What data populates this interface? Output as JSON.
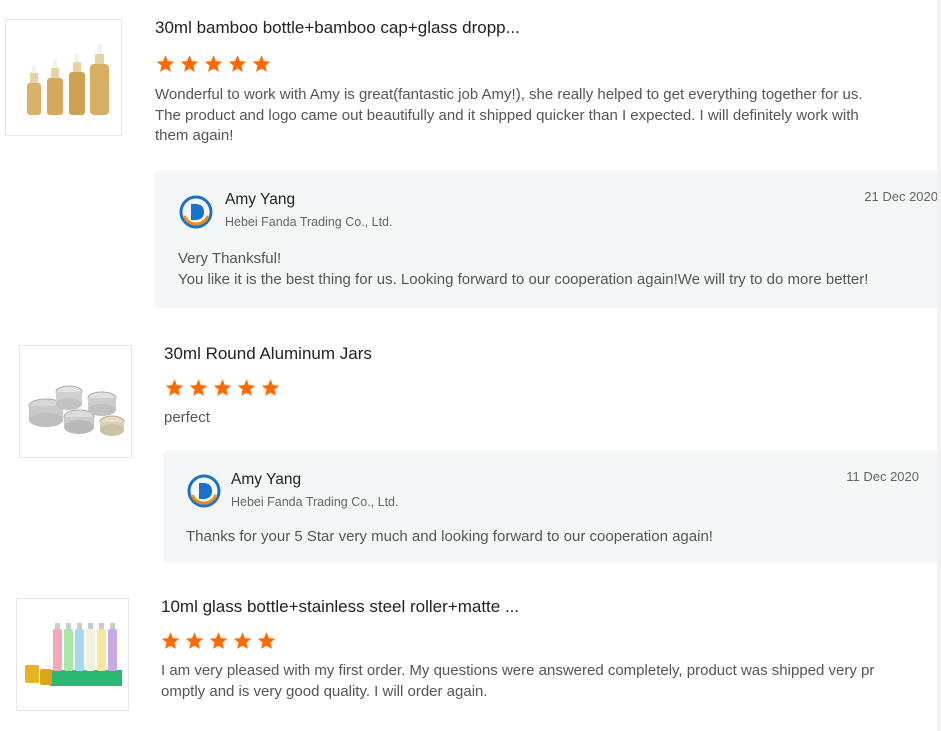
{
  "reviews": [
    {
      "product_title": "30ml bamboo bottle+bamboo cap+glass dropp...",
      "rating": 5,
      "text_lines": [
        "Wonderful to work with Amy is great(fantastic job Amy!), she really helped to get everything together for us.",
        "The product and logo came out beautifully and it shipped quicker than I expected. I will definitely work with",
        "them again!"
      ],
      "reply": {
        "name": "Amy Yang",
        "company": "Hebei Fanda Trading Co., Ltd.",
        "date": "21 Dec 2020",
        "lines": [
          "Very Thanksful!",
          "You like it is the best thing for us. Looking forward to our cooperation again!We will try to do more better!"
        ]
      }
    },
    {
      "product_title": "30ml Round Aluminum Jars",
      "rating": 5,
      "text_lines": [
        "perfect"
      ],
      "reply": {
        "name": "Amy Yang",
        "company": "Hebei Fanda Trading Co., Ltd.",
        "date": "11 Dec 2020",
        "lines": [
          "Thanks for your 5 Star very much and looking forward to our cooperation again!"
        ]
      }
    },
    {
      "product_title": "10ml glass bottle+stainless steel roller+matte ...",
      "rating": 5,
      "text_lines": [
        "I am very pleased with my first order. My questions were answered completely, product was shipped very pr",
        "omptly and is very good quality. I will order again."
      ]
    }
  ],
  "colors": {
    "star": "#ff6a00",
    "reply_bg": "#f5f6f8",
    "logo_blue": "#1a73c8",
    "logo_orange": "#f08a1c"
  },
  "icons": {
    "star": "star-icon",
    "company_logo": "company-logo-icon"
  }
}
